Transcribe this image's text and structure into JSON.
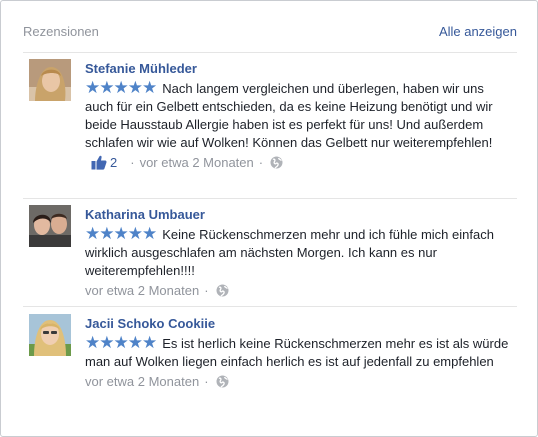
{
  "header": {
    "title": "Rezensionen",
    "see_all": "Alle anzeigen"
  },
  "colors": {
    "link": "#365899",
    "star": "#4f83c8",
    "meta": "#90949c",
    "border": "#c9ccd1"
  },
  "reviews": [
    {
      "name": "Stefanie Mühleder",
      "rating": 5,
      "text": "Nach langem vergleichen und überlegen, haben wir uns auch für ein Gelbett entschieden, da es keine Heizung benötigt und wir beide Hausstaub Allergie haben ist es perfekt für uns! Und außerdem schlafen wir wie auf Wolken! Können das Gelbett nur weiterempfehlen!",
      "likes": "2",
      "time": "vor etwa 2 Monaten",
      "dot": "·"
    },
    {
      "name": "Katharina Umbauer",
      "rating": 5,
      "text": "Keine Rückenschmerzen mehr und ich fühle mich einfach wirklich ausgeschlafen am nächsten Morgen. Ich kann es nur weiterempfehlen!!!!",
      "time": "vor etwa 2 Monaten",
      "dot": "·"
    },
    {
      "name": "Jacii Schoko Cookiie",
      "rating": 5,
      "text": "Es ist herlich keine Rückenschmerzen mehr es ist als würde man auf Wolken liegen einfach herlich es ist auf jedenfall zu empfehlen",
      "time": "vor etwa 2 Monaten",
      "dot": "·"
    }
  ],
  "star_glyph": "★"
}
